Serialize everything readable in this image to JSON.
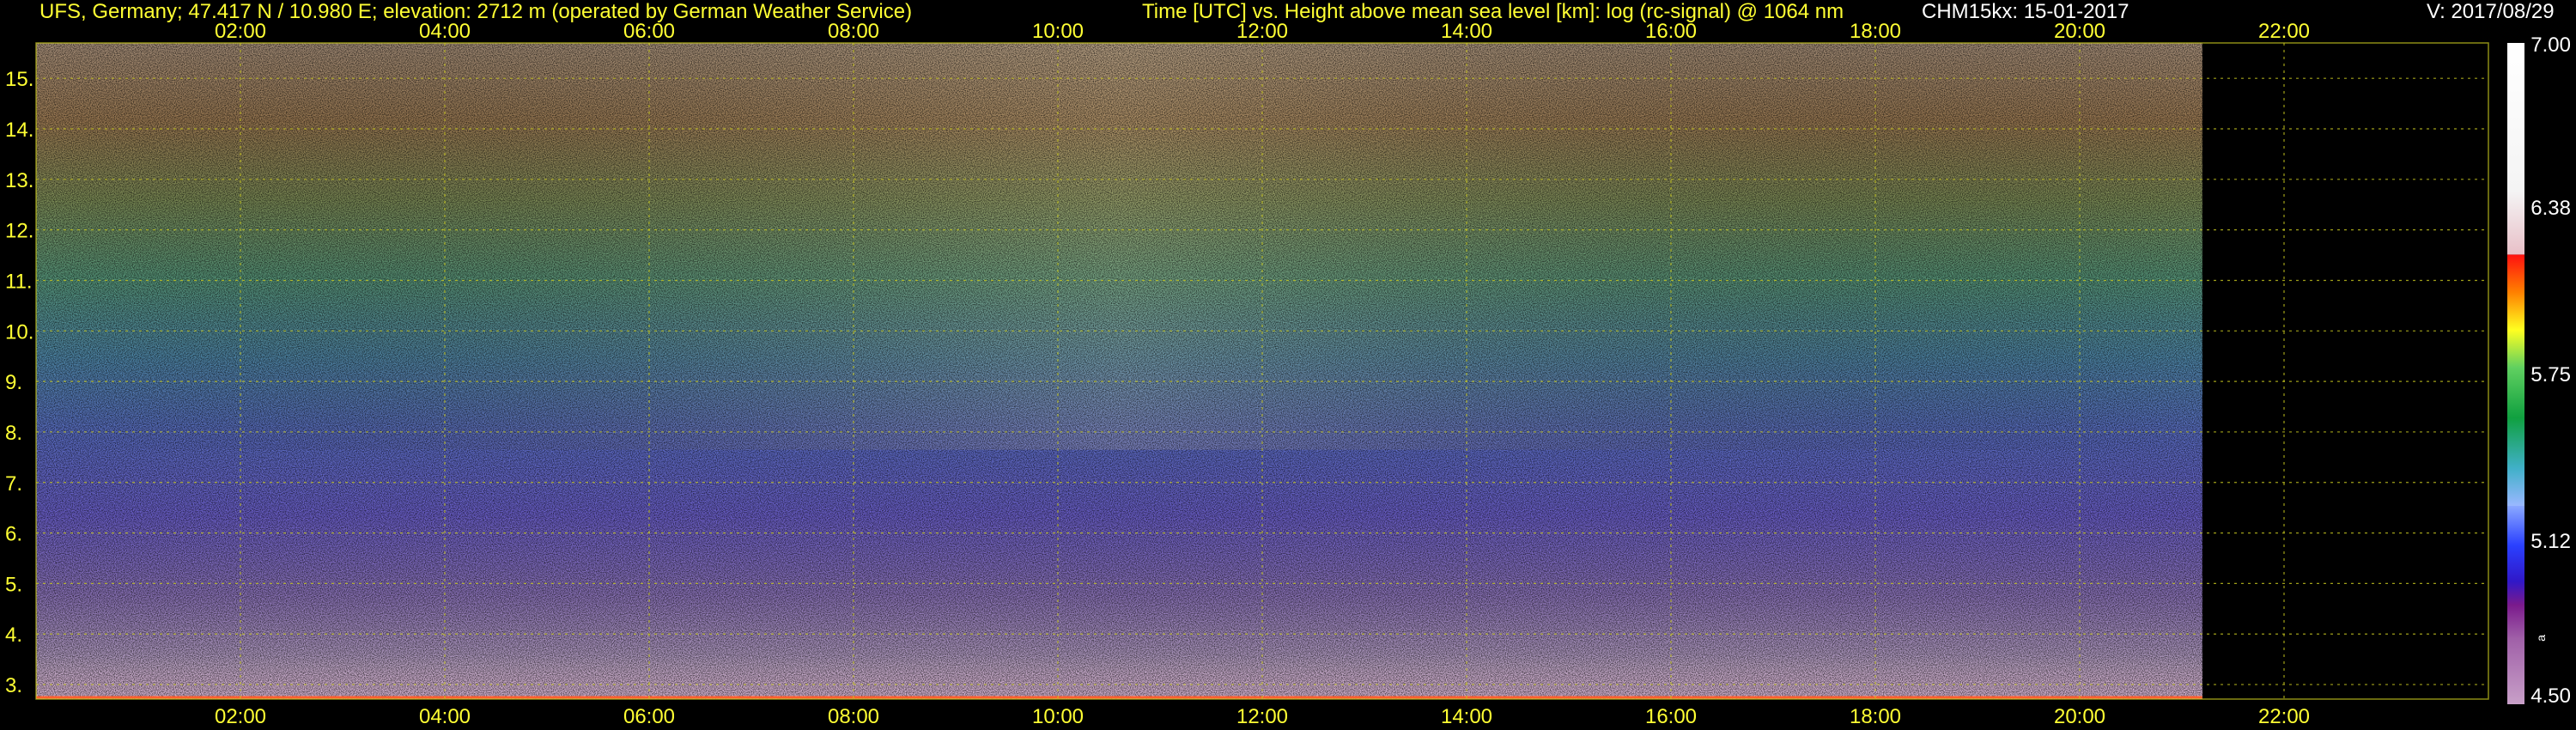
{
  "header": {
    "site": "UFS, Germany; 47.417 N / 10.980 E; elevation: 2712 m  (operated by German Weather Service)",
    "title": "Time [UTC] vs. Height above mean sea level [km]: log (rc-signal) @ 1064 nm",
    "instrument": "CHM15kx: 15-01-2017",
    "version": "V: 2017/08/29"
  },
  "colors": {
    "text_accent": "#ffff33",
    "text_white": "#ffffff",
    "background": "#000000",
    "grid": "#c8c820"
  },
  "chart_data": {
    "type": "heatmap",
    "title": "Time [UTC] vs. Height above mean sea level [km]: log (rc-signal) @ 1064 nm",
    "xlabel": "Time [UTC]",
    "ylabel": "Height above mean sea level [km]",
    "x_tick_labels": [
      "02:00",
      "04:00",
      "06:00",
      "08:00",
      "10:00",
      "12:00",
      "14:00",
      "16:00",
      "18:00",
      "20:00",
      "22:00"
    ],
    "x_tick_hours": [
      2,
      4,
      6,
      8,
      10,
      12,
      14,
      16,
      18,
      20,
      22
    ],
    "xlim_hours": [
      0,
      24
    ],
    "data_end_hour": 21.2,
    "y_tick_labels": [
      "3.",
      "4.",
      "5.",
      "6.",
      "7.",
      "8.",
      "9.",
      "10.",
      "11.",
      "12.",
      "13.",
      "14.",
      "15."
    ],
    "y_tick_values": [
      3,
      4,
      5,
      6,
      7,
      8,
      9,
      10,
      11,
      12,
      13,
      14,
      15
    ],
    "ylim_km": [
      2.712,
      15.7
    ],
    "grid": true,
    "colorbar": {
      "min": 4.5,
      "max": 7.0,
      "tick_labels": [
        "7.00",
        "6.38",
        "5.75",
        "5.12",
        "4.50"
      ],
      "tick_values": [
        7.0,
        6.38,
        5.75,
        5.12,
        4.5
      ],
      "unit_mark": "a"
    }
  }
}
